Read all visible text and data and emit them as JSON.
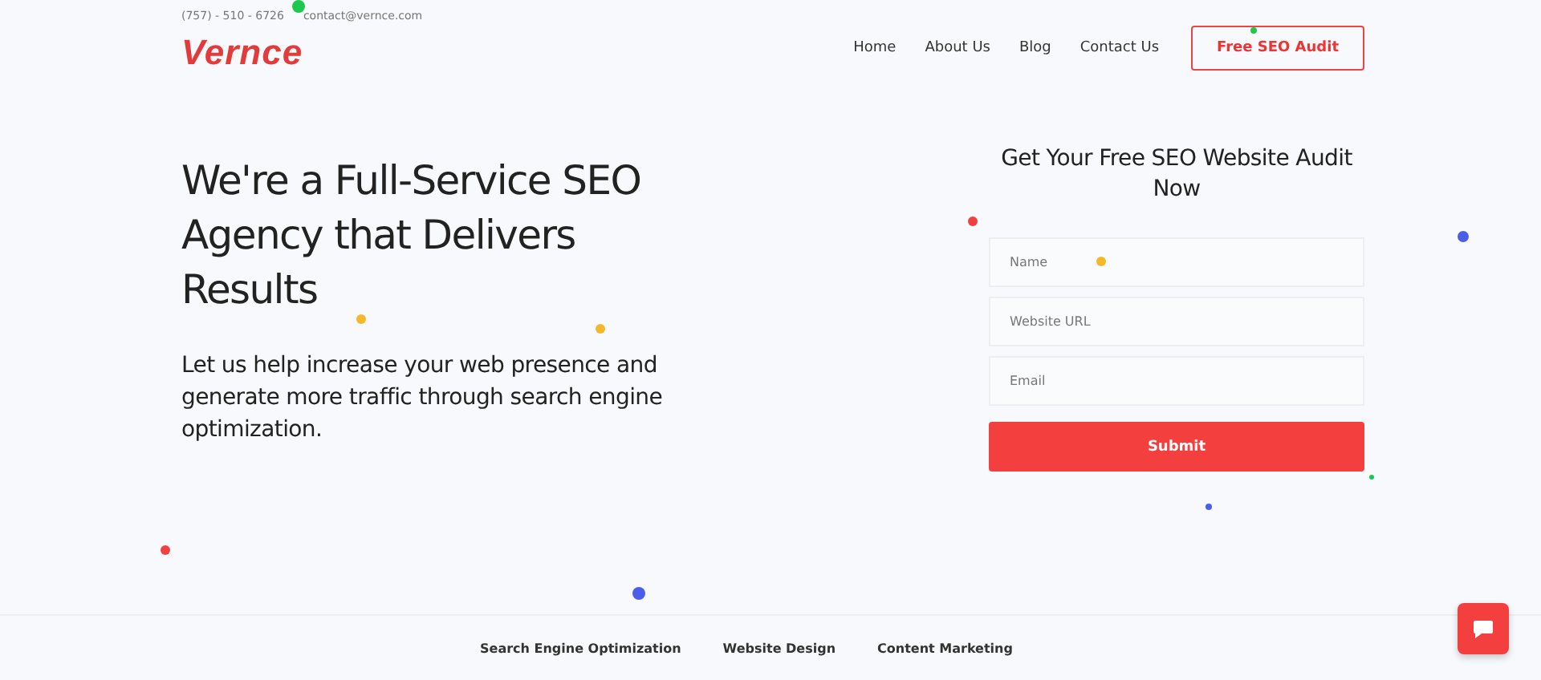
{
  "topbar": {
    "phone": "(757) - 510 - 6726",
    "email": "contact@vernce.com"
  },
  "logo": "Vernce",
  "nav": [
    {
      "label": "Home"
    },
    {
      "label": "About Us"
    },
    {
      "label": "Blog"
    },
    {
      "label": "Contact Us"
    }
  ],
  "cta": "Free SEO Audit",
  "hero": {
    "title": "We're a Full-Service SEO Agency that Delivers Results",
    "text": "Let us help increase your web presence and generate more traffic through search engine optimization."
  },
  "form": {
    "title": "Get Your Free SEO Website Audit Now",
    "fields": [
      {
        "placeholder": "Name"
      },
      {
        "placeholder": "Website URL"
      },
      {
        "placeholder": "Email"
      }
    ],
    "submit": "Submit"
  },
  "services": [
    {
      "label": "Search Engine Optimization"
    },
    {
      "label": "Website Design"
    },
    {
      "label": "Content Marketing"
    }
  ]
}
